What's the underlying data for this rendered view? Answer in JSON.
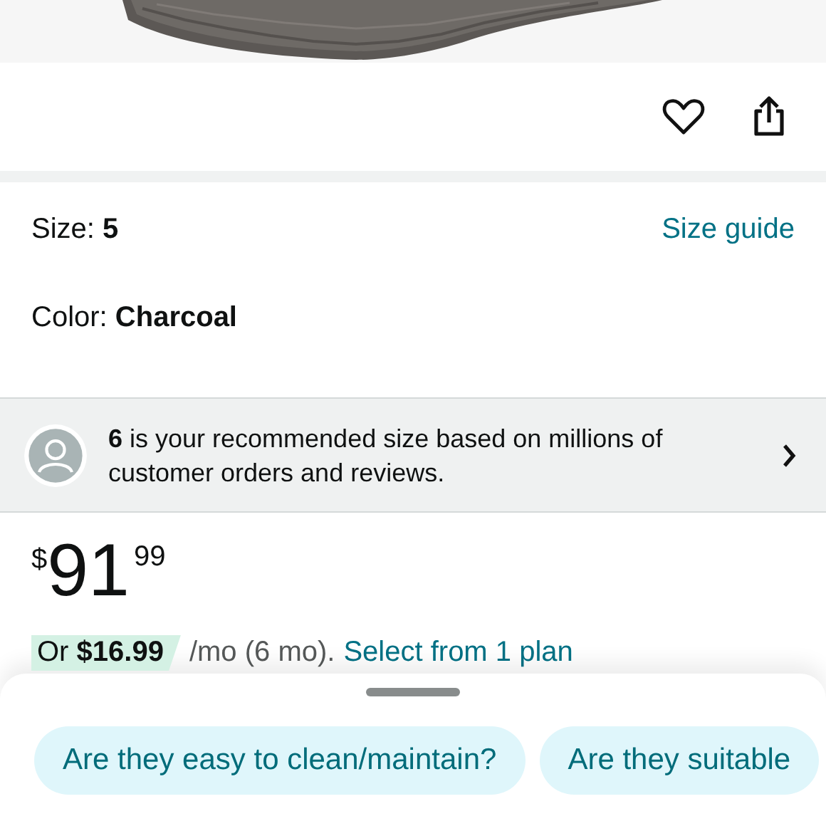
{
  "size": {
    "label": "Size: **5**",
    "guide_link": "Size guide"
  },
  "color": {
    "label": "Color: **Charcoal**"
  },
  "recommendation": {
    "text": "**6** is your recommended size based on millions of customer orders and reviews."
  },
  "price": {
    "currency": "$",
    "whole": "91",
    "fraction": "99"
  },
  "installment": {
    "offer": "Or **$16.99**",
    "terms": "/mo (6 mo).",
    "link": "Select from 1 plan"
  },
  "suggestions": [
    "Are they easy to clean/maintain?",
    "Are they suitable"
  ]
}
